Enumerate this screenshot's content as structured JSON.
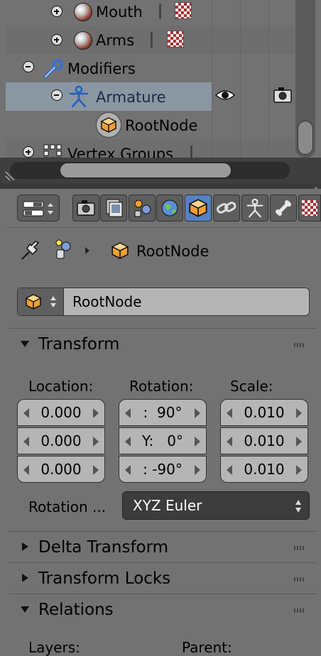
{
  "outliner": {
    "rows": [
      {
        "label": "Mouth",
        "expand": "plus"
      },
      {
        "label": "Arms",
        "expand": "plus"
      },
      {
        "label": "Modifiers",
        "expand": "minus"
      },
      {
        "label": "Armature",
        "expand": "minus"
      },
      {
        "label": "RootNode"
      },
      {
        "label": "Vertex Groups",
        "expand": "plus"
      }
    ]
  },
  "properties": {
    "breadcrumb": {
      "object_name": "RootNode"
    },
    "datablock": {
      "name": "RootNode"
    },
    "transform": {
      "title": "Transform",
      "location": {
        "label": "Location:",
        "values": [
          "0.000",
          "0.000",
          "0.000"
        ]
      },
      "rotation": {
        "label": "Rotation:",
        "values": [
          ":  90°",
          "Y:   0°",
          ": -90°"
        ]
      },
      "scale": {
        "label": "Scale:",
        "values": [
          "0.010",
          "0.010",
          "0.010"
        ]
      },
      "rotation_mode_label": "Rotation ...",
      "rotation_mode_value": "XYZ Euler"
    },
    "panels": {
      "delta_transform": "Delta Transform",
      "transform_locks": "Transform Locks",
      "relations": "Relations"
    },
    "relations": {
      "layers_label": "Layers:",
      "parent_label": "Parent:"
    }
  },
  "colors": {
    "accent": "#5680c2",
    "bg": "#727272",
    "selected_row": "#8a96a2"
  }
}
